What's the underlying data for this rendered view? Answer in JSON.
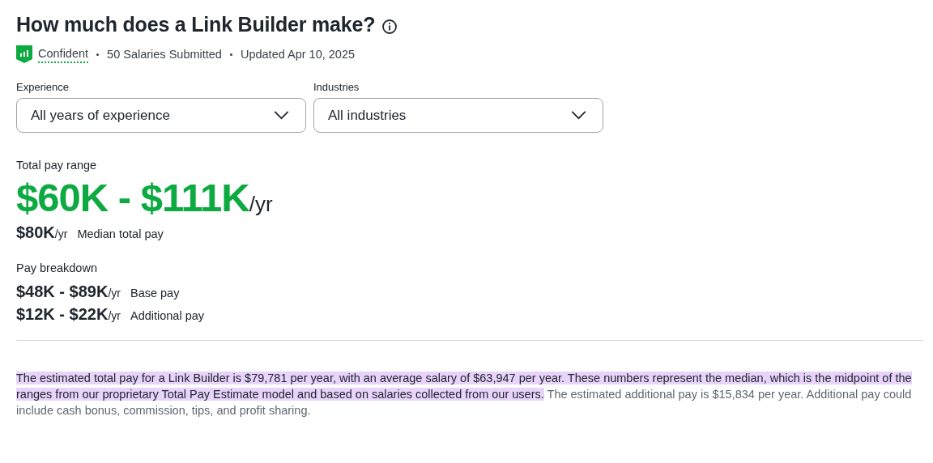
{
  "title": "How much does a Link Builder make?",
  "meta": {
    "confidence": "Confident",
    "items": [
      "50 Salaries Submitted",
      "Updated Apr 10, 2025"
    ]
  },
  "filters": [
    {
      "label": "Experience",
      "value": "All years of experience"
    },
    {
      "label": "Industries",
      "value": "All industries"
    }
  ],
  "total_pay": {
    "label": "Total pay range",
    "range": "$60K - $111K",
    "unit": "/yr"
  },
  "median": {
    "amount": "$80K",
    "unit": "/yr",
    "label": "Median total pay"
  },
  "breakdown": {
    "title": "Pay breakdown",
    "rows": [
      {
        "range": "$48K - $89K",
        "unit": "/yr",
        "label": "Base pay"
      },
      {
        "range": "$12K - $22K",
        "unit": "/yr",
        "label": "Additional pay"
      }
    ]
  },
  "description": {
    "highlighted": "The estimated total pay for a Link Builder is $79,781 per year, with an average salary of $63,947 per year. These numbers represent the median, which is the midpoint of the ranges from our proprietary Total Pay Estimate model and based on salaries collected from our users.",
    "rest": "The estimated additional pay is $15,834 per year. Additional pay could include cash bonus, commission, tips, and profit sharing."
  }
}
